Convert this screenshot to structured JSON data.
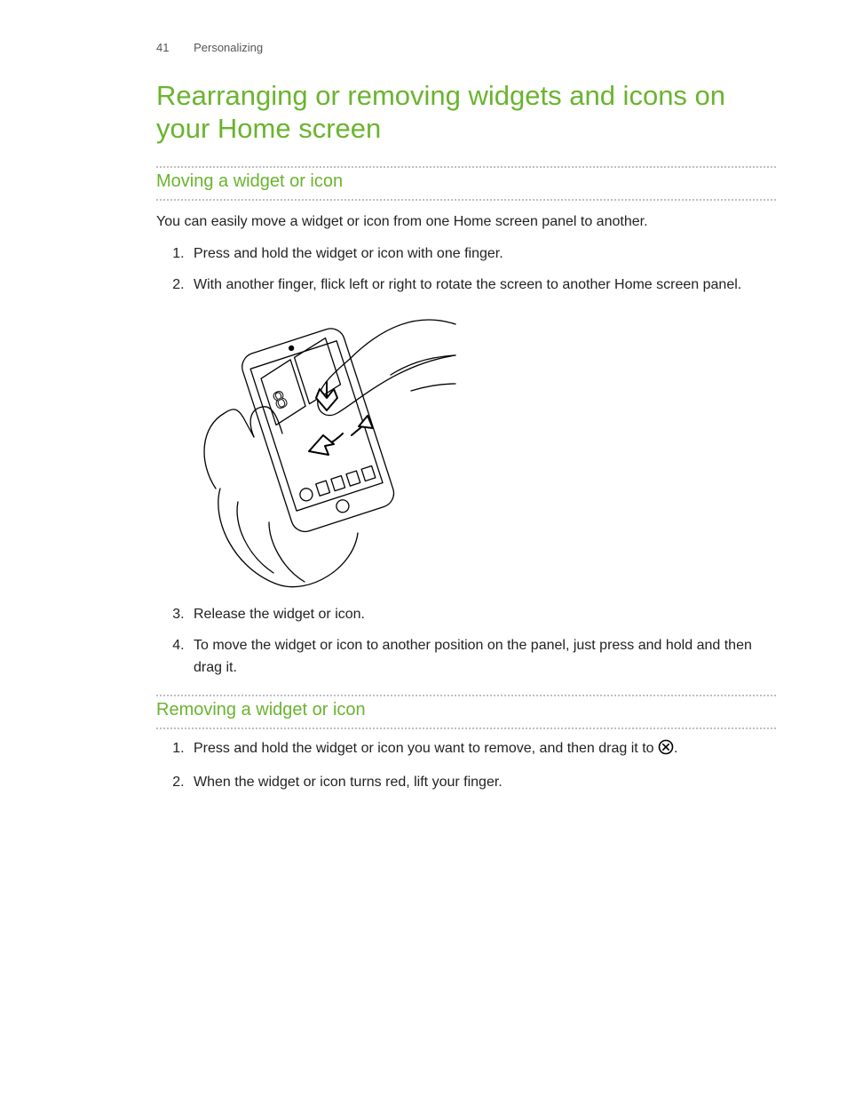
{
  "header": {
    "page_number": "41",
    "section_label": "Personalizing"
  },
  "title": "Rearranging or removing widgets and icons on your Home screen",
  "section_moving": {
    "heading": "Moving a widget or icon",
    "intro": "You can easily move a widget or icon from one Home screen panel to another.",
    "steps": {
      "s1": "Press and hold the widget or icon with one finger.",
      "s2": "With another finger, flick left or right to rotate the screen to another Home screen panel.",
      "s3": "Release the widget or icon.",
      "s4": "To move the widget or icon to another position on the panel, just press and hold and then drag it."
    }
  },
  "section_removing": {
    "heading": "Removing a widget or icon",
    "steps": {
      "s1_pre": "Press and hold the widget or icon you want to remove, and then drag it to ",
      "s1_post": ".",
      "s2": "When the widget or icon turns red, lift your finger."
    }
  }
}
